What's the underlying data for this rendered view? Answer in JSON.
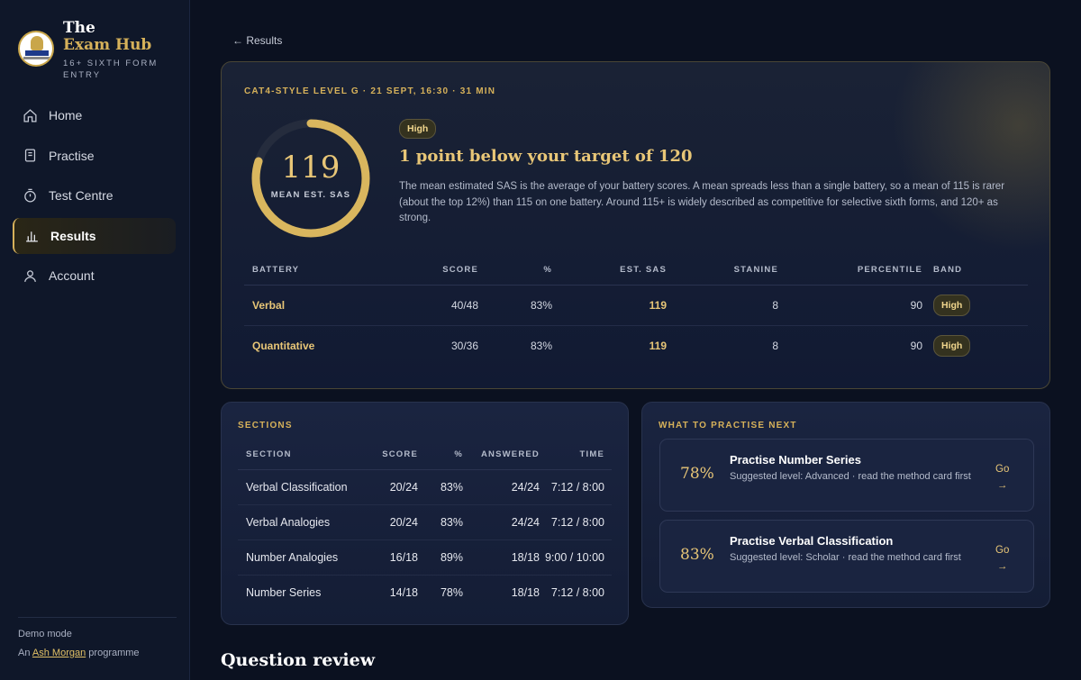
{
  "brand": {
    "line1": "The",
    "line2": "Exam Hub",
    "subtitle": "16+ SIXTH FORM ENTRY",
    "logo_text": "Ash Morgan"
  },
  "nav": [
    {
      "label": "Home",
      "icon": "home-icon",
      "active": false
    },
    {
      "label": "Practise",
      "icon": "document-icon",
      "active": false
    },
    {
      "label": "Test Centre",
      "icon": "stopwatch-icon",
      "active": false
    },
    {
      "label": "Results",
      "icon": "bar-chart-icon",
      "active": true
    },
    {
      "label": "Account",
      "icon": "user-icon",
      "active": false
    }
  ],
  "footer": {
    "demo": "Demo mode",
    "prefix": "An",
    "author": "Ash Morgan",
    "suffix": "programme"
  },
  "back_link": "← Results",
  "hero": {
    "eyebrow": "CAT4-STYLE LEVEL G · 21 SEPT, 16:30 · 31 MIN",
    "score": "119",
    "score_fraction": 0.8,
    "score_label": "MEAN EST. SAS",
    "band": "High",
    "title": "1 point below your target of 120",
    "description": "The mean estimated SAS is the average of your battery scores. A mean spreads less than a single battery, so a mean of 115 is rarer (about the top 12%) than 115 on one battery. Around 115+ is widely described as competitive for selective sixth forms, and 120+ as strong."
  },
  "battery_table": {
    "headers": [
      "BATTERY",
      "SCORE",
      "%",
      "EST. SAS",
      "STANINE",
      "PERCENTILE",
      "BAND"
    ],
    "rows": [
      [
        "Verbal",
        "40/48",
        "83%",
        "119",
        "8",
        "90",
        "High"
      ],
      [
        "Quantitative",
        "30/36",
        "83%",
        "119",
        "8",
        "90",
        "High"
      ]
    ]
  },
  "sections": {
    "title": "SECTIONS",
    "headers": [
      "SECTION",
      "SCORE",
      "%",
      "ANSWERED",
      "TIME"
    ],
    "rows": [
      [
        "Verbal Classification",
        "20/24",
        "83%",
        "24/24",
        "7:12 / 8:00"
      ],
      [
        "Verbal Analogies",
        "20/24",
        "83%",
        "24/24",
        "7:12 / 8:00"
      ],
      [
        "Number Analogies",
        "16/18",
        "89%",
        "18/18",
        "9:00 / 10:00"
      ],
      [
        "Number Series",
        "14/18",
        "78%",
        "18/18",
        "7:12 / 8:00"
      ]
    ]
  },
  "practise_next": {
    "title": "WHAT TO PRACTISE NEXT",
    "cards": [
      {
        "pct": "78%",
        "title": "Practise Number Series",
        "sub": "Suggested level: Advanced · read the method card first",
        "go": "Go",
        "arrow": "→"
      },
      {
        "pct": "83%",
        "title": "Practise Verbal Classification",
        "sub": "Suggested level: Scholar · read the method card first",
        "go": "Go",
        "arrow": "→"
      }
    ]
  },
  "question_review": "Question review",
  "colors": {
    "accent": "#d6b15a",
    "background": "#0b1120",
    "sidebar": "#0f1729"
  }
}
